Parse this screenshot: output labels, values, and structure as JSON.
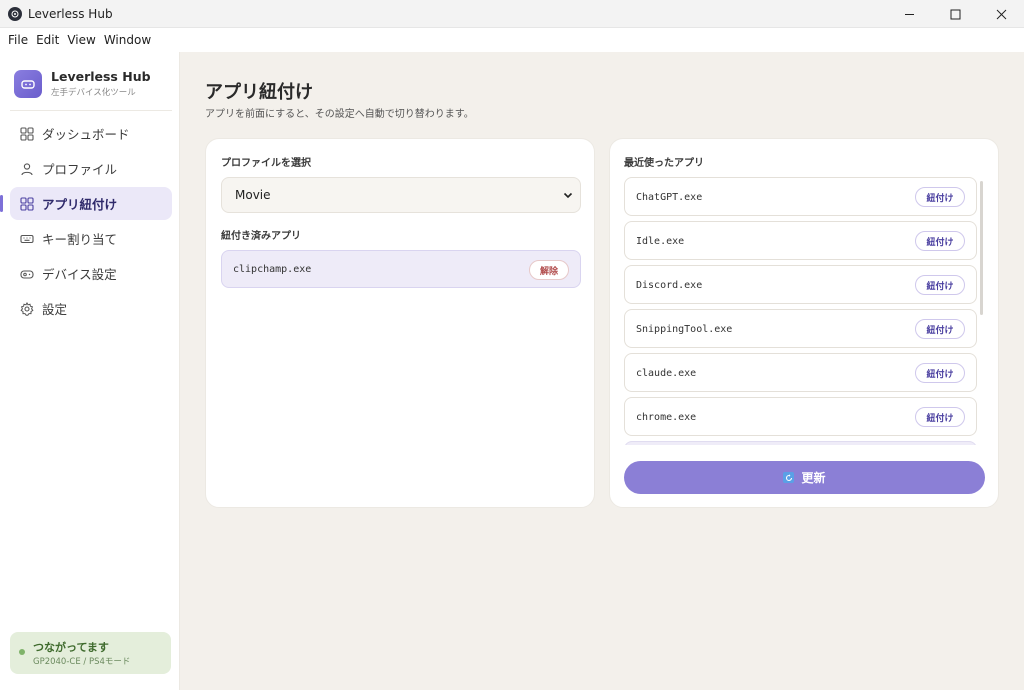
{
  "window": {
    "title": "Leverless Hub"
  },
  "menu": [
    "File",
    "Edit",
    "View",
    "Window"
  ],
  "sidebar": {
    "brand_name": "Leverless Hub",
    "brand_sub": "左手デバイス化ツール",
    "items": [
      {
        "label": "ダッシュボード",
        "icon": "grid-icon",
        "active": false
      },
      {
        "label": "プロファイル",
        "icon": "user-icon",
        "active": false
      },
      {
        "label": "アプリ紐付け",
        "icon": "grid-icon",
        "active": true
      },
      {
        "label": "キー割り当て",
        "icon": "keyboard-icon",
        "active": false
      },
      {
        "label": "デバイス設定",
        "icon": "gamepad-icon",
        "active": false
      },
      {
        "label": "設定",
        "icon": "gear-icon",
        "active": false
      }
    ],
    "status": {
      "title": "つながってます",
      "sub": "GP2040-CE / PS4モード",
      "color": "#7fb36a"
    }
  },
  "main": {
    "title": "アプリ紐付け",
    "description": "アプリを前面にすると、その設定へ自動で切り替わります。",
    "profile_section_label": "プロファイルを選択",
    "profile_selected": "Movie",
    "linked_section_label": "紐付き済みアプリ",
    "linked_apps": [
      {
        "name": "clipchamp.exe",
        "action": "解除"
      }
    ],
    "recent_section_label": "最近使ったアプリ",
    "recent_apps": [
      {
        "name": "ChatGPT.exe",
        "action": "紐付け"
      },
      {
        "name": "Idle.exe",
        "action": "紐付け"
      },
      {
        "name": "Discord.exe",
        "action": "紐付け"
      },
      {
        "name": "SnippingTool.exe",
        "action": "紐付け"
      },
      {
        "name": "claude.exe",
        "action": "紐付け"
      },
      {
        "name": "chrome.exe",
        "action": "紐付け"
      }
    ],
    "refresh_label": "更新"
  },
  "colors": {
    "accent": "#8b7fd6",
    "active_bg": "#ebe8f8",
    "background": "#f3f0eb"
  }
}
